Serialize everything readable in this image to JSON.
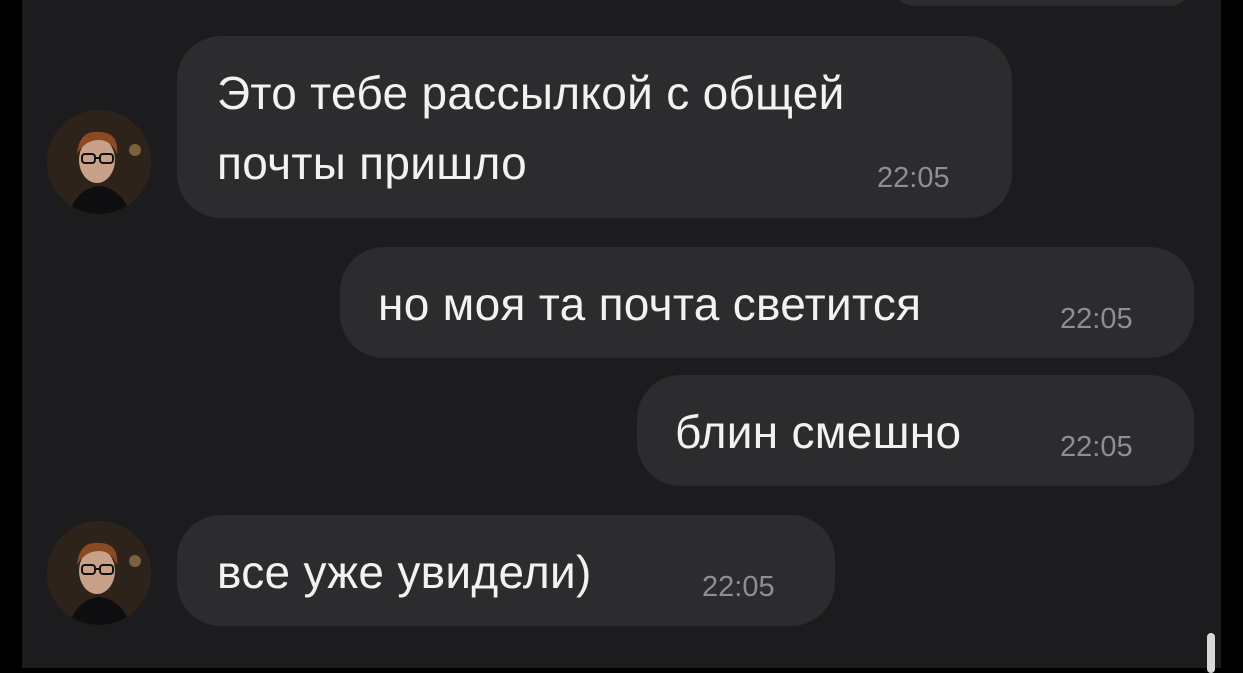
{
  "chat": {
    "messages": [
      {
        "direction": "incoming",
        "lines": [
          "Это тебе рассылкой с общей",
          "почты пришло"
        ],
        "time": "22:05"
      },
      {
        "direction": "outgoing",
        "text": "но моя та почта светится",
        "time": "22:05"
      },
      {
        "direction": "outgoing",
        "text": "блин смешно",
        "time": "22:05"
      },
      {
        "direction": "incoming",
        "text": "все уже увидели)",
        "time": "22:05"
      }
    ]
  },
  "colors": {
    "background": "#1c1c1e",
    "bubble": "#2c2c2e",
    "text": "#f2f2f2",
    "timestamp": "#8e8e93"
  }
}
